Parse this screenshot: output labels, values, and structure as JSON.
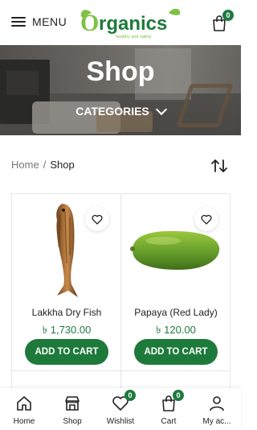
{
  "header": {
    "menu_label": "MENU",
    "logo_text": "Organics",
    "logo_tagline": "healthy and safety",
    "cart_count": "0"
  },
  "banner": {
    "title": "Shop",
    "categories_label": "CATEGORIES"
  },
  "breadcrumb": {
    "home": "Home",
    "separator": "/",
    "current": "Shop"
  },
  "products": [
    {
      "name": "Lakkha Dry Fish",
      "price": "৳ 1,730.00",
      "button": "ADD TO CART"
    },
    {
      "name": "Papaya (Red Lady)",
      "price": "৳ 120.00",
      "button": "ADD TO CART"
    }
  ],
  "bottom_nav": {
    "items": [
      {
        "label": "Home",
        "icon": "home-icon"
      },
      {
        "label": "Shop",
        "icon": "shop-icon"
      },
      {
        "label": "Wishlist",
        "icon": "heart-icon",
        "badge": "0"
      },
      {
        "label": "Cart",
        "icon": "cart-icon",
        "badge": "0"
      },
      {
        "label": "My ac...",
        "icon": "user-icon"
      }
    ]
  },
  "colors": {
    "brand_green": "#1d7a3a",
    "logo_light_green": "#7dc242"
  }
}
